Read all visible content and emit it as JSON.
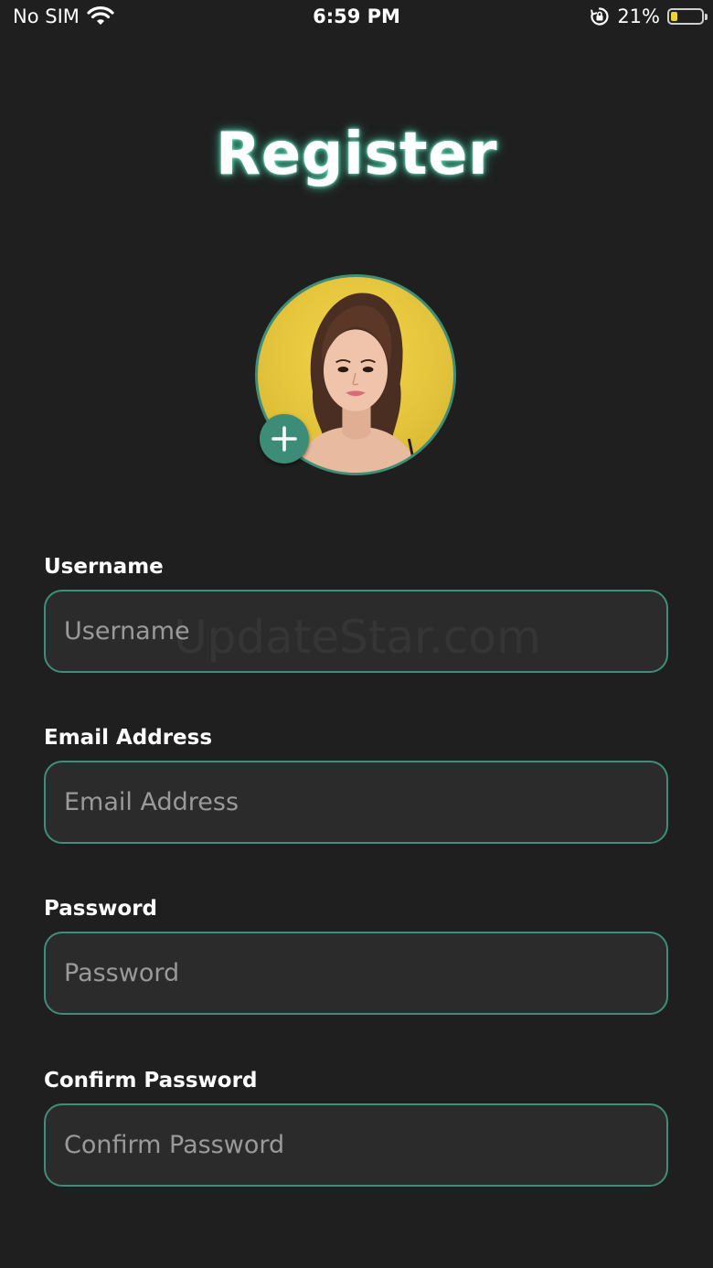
{
  "status_bar": {
    "carrier": "No SIM",
    "time": "6:59 PM",
    "battery_percent": "21%",
    "battery_level": 0.21,
    "battery_color": "#f3d132"
  },
  "page": {
    "title": "Register",
    "accent_color": "#3f8e78",
    "background_color": "#1f1f1f"
  },
  "avatar": {
    "icon": "plus-icon"
  },
  "form": {
    "fields": [
      {
        "label": "Username",
        "placeholder": "Username",
        "value": ""
      },
      {
        "label": "Email Address",
        "placeholder": "Email Address",
        "value": ""
      },
      {
        "label": "Password",
        "placeholder": "Password",
        "value": ""
      },
      {
        "label": "Confirm Password",
        "placeholder": "Confirm Password",
        "value": ""
      }
    ]
  },
  "watermark": "UpdateStar.com"
}
